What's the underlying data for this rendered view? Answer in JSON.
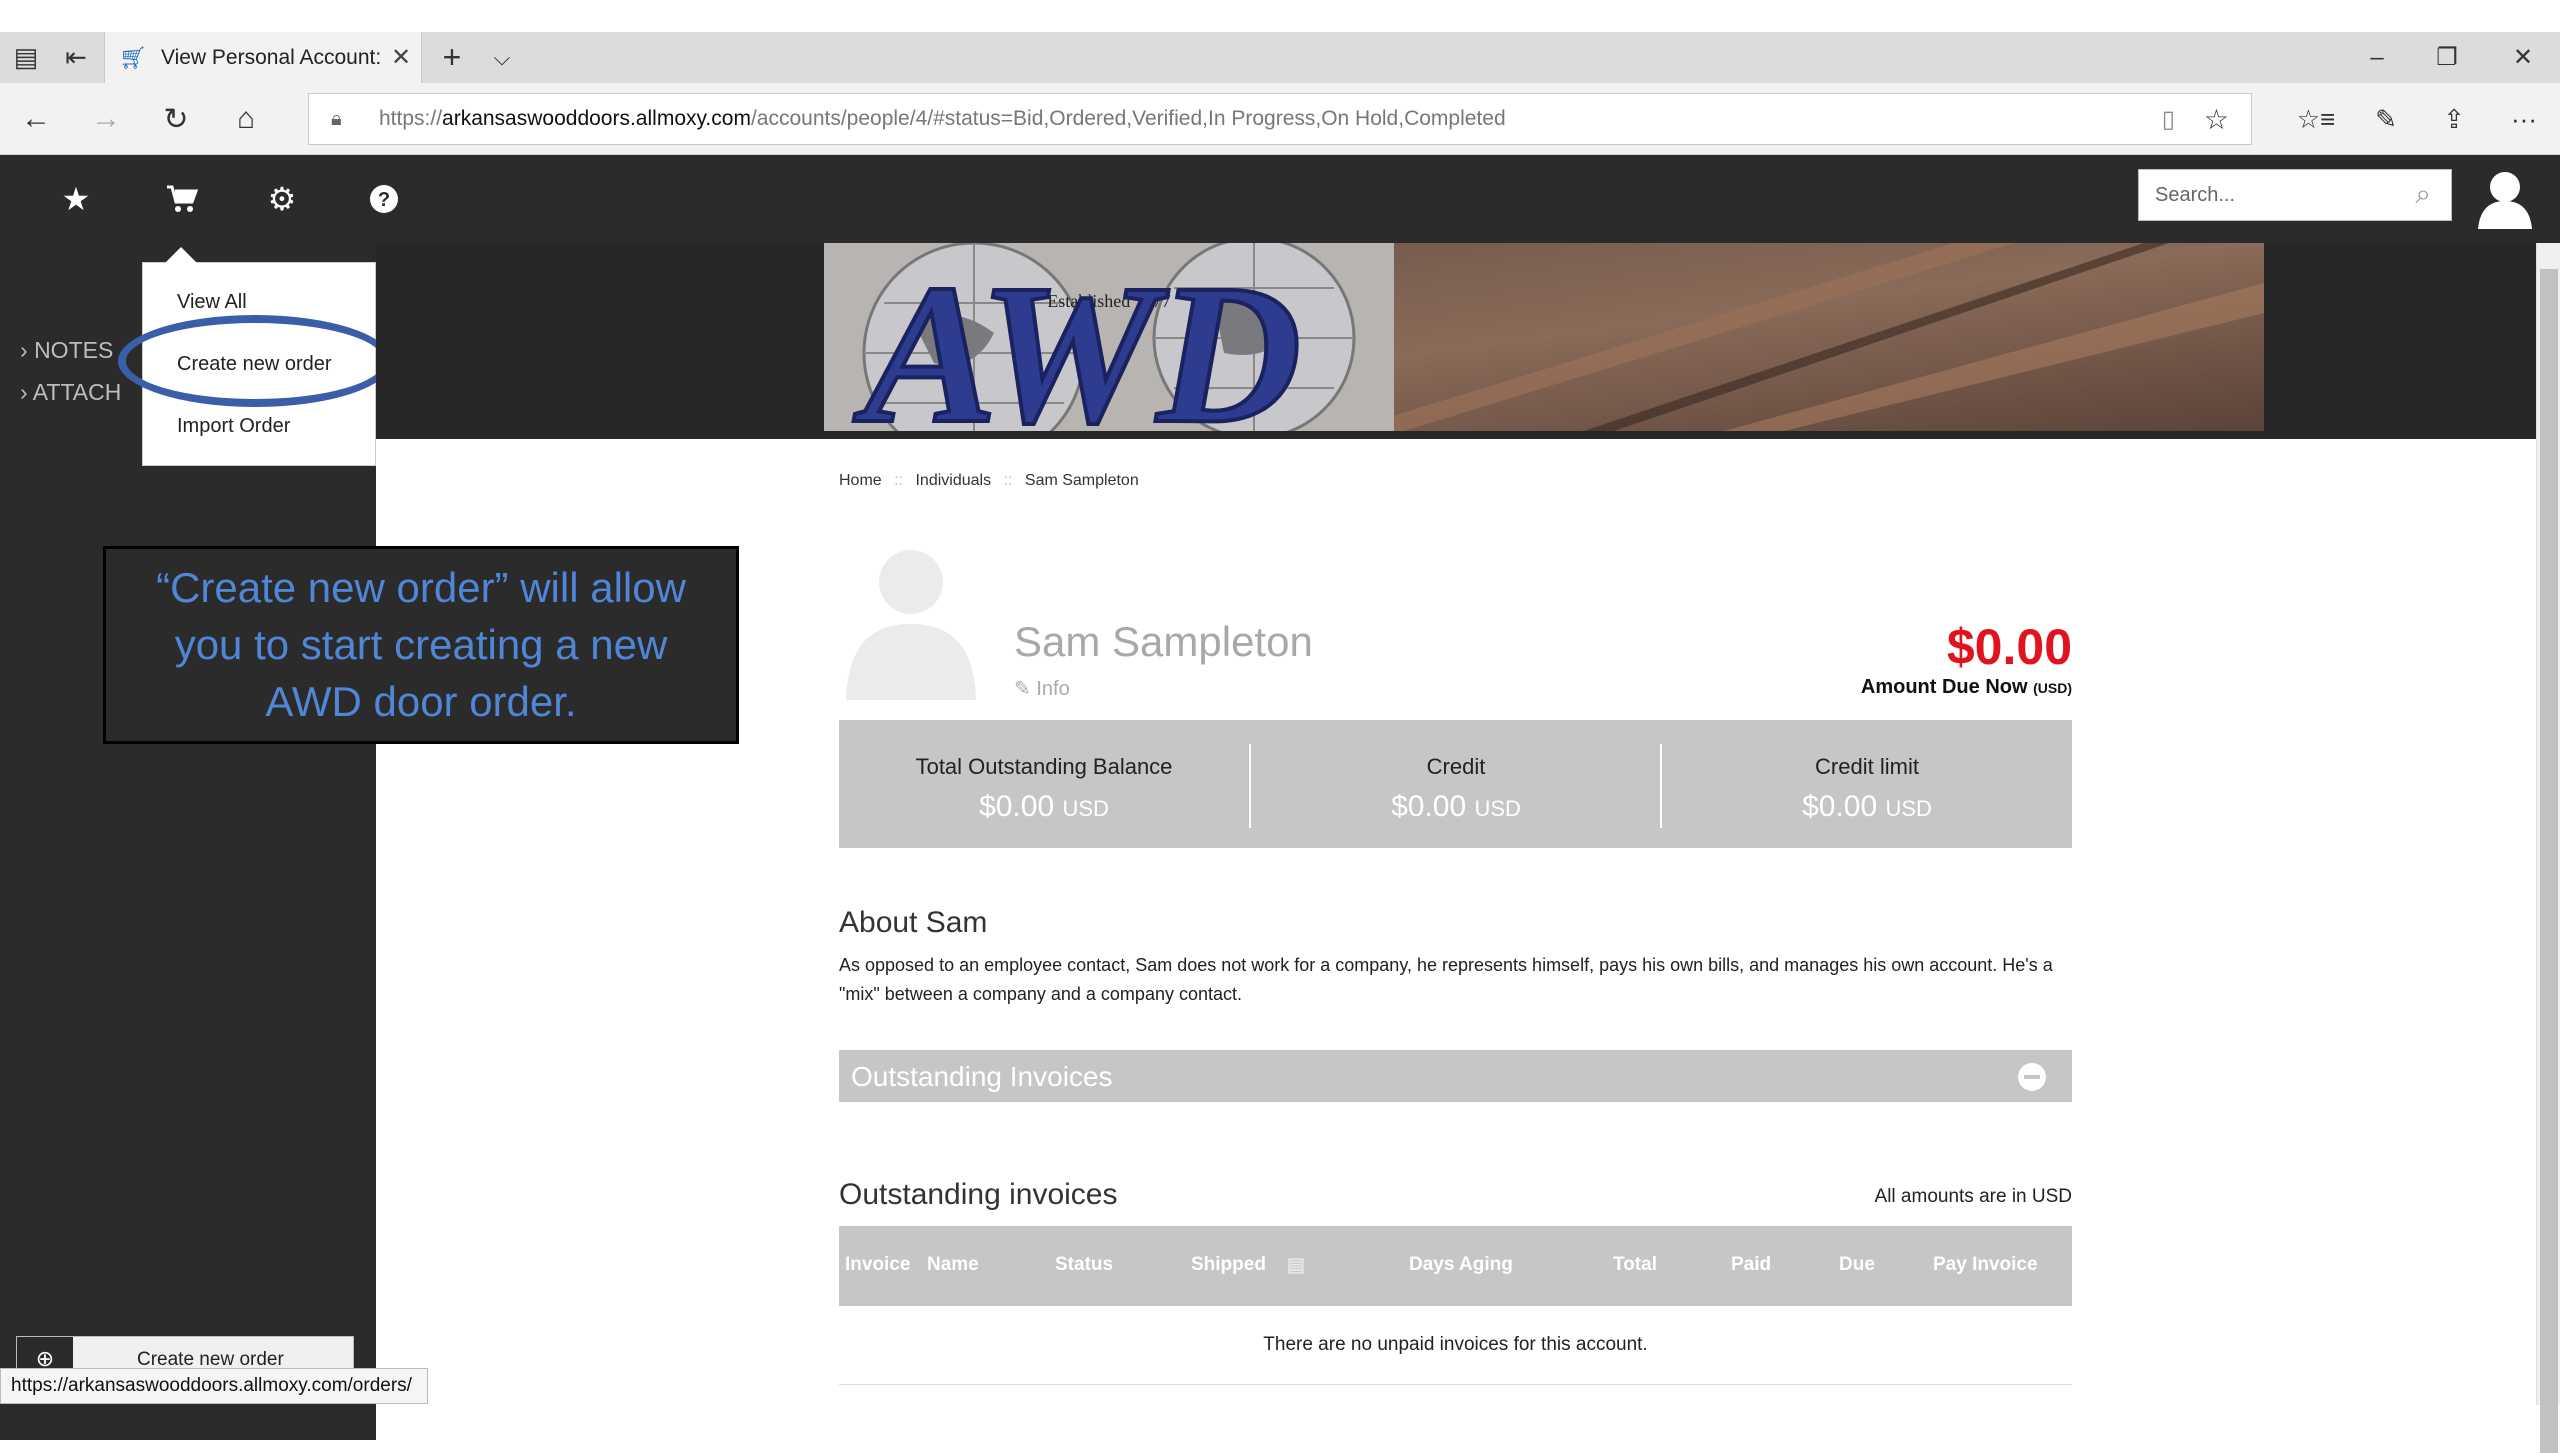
{
  "browser": {
    "tab_title": "View Personal Account:",
    "tab_close": "✕",
    "new_tab": "+",
    "tab_list": "⌵",
    "url_prefix": "https://",
    "url_host": "arkansaswooddoors.allmoxy.com",
    "url_path": "/accounts/people/4/#status=Bid,Ordered,Verified,In Progress,On Hold,Completed",
    "window_controls": {
      "minimize": "–",
      "restore": "❐",
      "close": "✕"
    },
    "nav": {
      "back": "←",
      "forward": "→",
      "refresh": "↻",
      "home": "⌂"
    },
    "toolbar": {
      "favorites": "☆≡",
      "pen": "✎",
      "share": "⇪",
      "more": "···"
    }
  },
  "header": {
    "search_placeholder": "Search...",
    "icons": [
      "star-icon",
      "cart-icon",
      "gear-icon",
      "help-icon"
    ]
  },
  "sidebar": {
    "items": [
      {
        "label": "NOTES"
      },
      {
        "label": "ATTACH"
      }
    ],
    "create_button_label": "Create new order"
  },
  "dropdown": {
    "items": [
      {
        "label": "View All"
      },
      {
        "label": "Create new order"
      },
      {
        "label": "Import Order"
      }
    ]
  },
  "callout": {
    "line1": "“Create new order” will allow",
    "line2": "you to start creating a new",
    "line3": "AWD door order."
  },
  "status_url": "https://arkansaswooddoors.allmoxy.com/orders/",
  "banner": {
    "text": "AWD",
    "established": "Established 1977"
  },
  "breadcrumb": {
    "items": [
      "Home",
      "Individuals",
      "Sam Sampleton"
    ],
    "separator": "::"
  },
  "profile": {
    "name": "Sam Sampleton",
    "info_link": "Info",
    "amount_due": "$0.00",
    "amount_due_label": "Amount Due Now",
    "amount_due_unit": "(USD)"
  },
  "balances": [
    {
      "title": "Total Outstanding Balance",
      "value": "$0.00",
      "unit": "USD"
    },
    {
      "title": "Credit",
      "value": "$0.00",
      "unit": "USD"
    },
    {
      "title": "Credit limit",
      "value": "$0.00",
      "unit": "USD"
    }
  ],
  "about": {
    "heading": "About Sam",
    "text": "As opposed to an employee contact, Sam does not work for a company, he represents himself, pays his own bills, and manages his own account. He's a \"mix\" between a company and a company contact."
  },
  "outstanding_bar_title": "Outstanding Invoices",
  "invoices": {
    "heading": "Outstanding invoices",
    "note": "All amounts are in USD",
    "columns": [
      "Invoice",
      "Name",
      "Status",
      "Shipped",
      "Days Aging",
      "Total",
      "Paid",
      "Due",
      "Pay Invoice"
    ],
    "empty_message": "There are no unpaid invoices for this account."
  },
  "colors": {
    "dark": "#2b2b2b",
    "panel_gray": "#c6c6c6",
    "amount_red": "#e0141e",
    "annotation_blue": "#3a5ea8"
  }
}
